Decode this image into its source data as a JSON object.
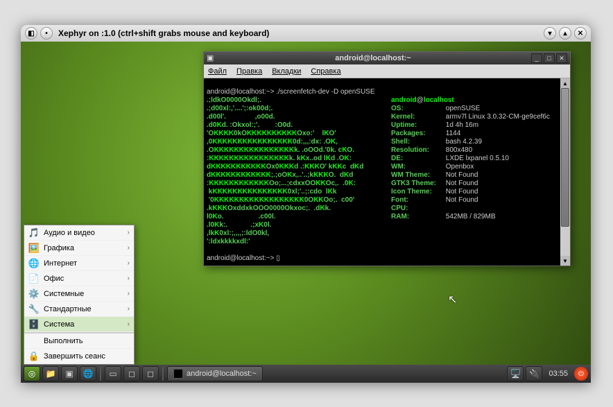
{
  "outer": {
    "title": "Xephyr on :1.0 (ctrl+shift grabs mouse and keyboard)"
  },
  "taskbar": {
    "task_label": "android@localhost:~",
    "clock": "03:55"
  },
  "startmenu": {
    "items": [
      {
        "label": "Аудио и видео",
        "icon": "🎵",
        "sub": true
      },
      {
        "label": "Графика",
        "icon": "🖼️",
        "sub": true
      },
      {
        "label": "Интернет",
        "icon": "🌐",
        "sub": true
      },
      {
        "label": "Офис",
        "icon": "📄",
        "sub": true
      },
      {
        "label": "Системные",
        "icon": "⚙️",
        "sub": true
      },
      {
        "label": "Стандартные",
        "icon": "🔧",
        "sub": true
      },
      {
        "label": "Система",
        "icon": "🗄️",
        "sub": true,
        "sel": true
      },
      {
        "label": "Выполнить",
        "icon": "",
        "sub": false
      },
      {
        "label": "Завершить сеанс",
        "icon": "🔒",
        "sub": false
      }
    ]
  },
  "terminal": {
    "title": "android@localhost:~",
    "menus": {
      "file": "Файл",
      "edit": "Правка",
      "tabs": "Вкладки",
      "help": "Справка"
    },
    "prompt1": "android@localhost:~> ./screenfetch-dev -D openSUSE",
    "prompt2": "android@localhost:~> ",
    "ascii": [
      ".;ldkO0000Okdl;.",
      ".;d00xl:,'....';:ok00d;.",
      ".d00l'.               ,o00d.",
      ".d0Kd. :Okxol:;'.        :O0d.",
      "'OKKKK0kOKKKKKKKKKKOxo:'    lKO'",
      ",0KKKKKKKKKKKKKKKK0d:,,,:dx: .OK,",
      ".OKKKKKKKKKKKKKKKKk. .oOOd.'0k. cKO.",
      ":KKKKKKKKKKKKKKKKk. kKx..od lKd .OK:",
      "dKKKKKKKKKKKOx0KKKd .:KKKO' kKKc  dKd",
      "dKKKKKKKKKKKK;.;oOKx,..'..;kKKKO.  dKd",
      ":KKKKKKKKKKKKOo;...;cdxxOOKKOc,.  .0K:",
      " kKKKKKKKKKKKKKKK0xl;'..;:cdo  lKk",
      " '0KKKKKKKKKKKKKKKKKK0OKKOo;.  c00'",
      ".kKKKOxddxkOOO0000Okxoc;.  .dKk.",
      "l0Ko.                  .c00l.",
      ".l0Kk:.            .;xK0l.",
      ",lkK0xl:;,,,,;:ldO0kl,",
      "':ldxkkkkxdl:'"
    ],
    "info": {
      "user": "android",
      "host": "localhost",
      "os_lbl": "OS:",
      "os": "openSUSE",
      "kernel_lbl": "Kernel:",
      "kernel": "armv7l Linux 3.0.32-CM-ge9cef6c",
      "uptime_lbl": "Uptime:",
      "uptime": "1d 4h 16m",
      "packages_lbl": "Packages:",
      "packages": "1144",
      "shell_lbl": "Shell:",
      "shell": "bash 4.2.39",
      "resolution_lbl": "Resolution:",
      "resolution": "800x480",
      "de_lbl": "DE:",
      "de": "LXDE lxpanel 0.5.10",
      "wm_lbl": "WM:",
      "wm": "Openbox",
      "wmtheme_lbl": "WM Theme:",
      "wmtheme": "Not Found",
      "gtk3_lbl": "GTK3 Theme:",
      "gtk3": "Not Found",
      "icon_lbl": "Icon Theme:",
      "icon": "Not Found",
      "font_lbl": "Font:",
      "font": "Not Found",
      "cpu_lbl": "CPU:",
      "cpu": "",
      "ram_lbl": "RAM:",
      "ram": "542MB / 829MB"
    }
  }
}
